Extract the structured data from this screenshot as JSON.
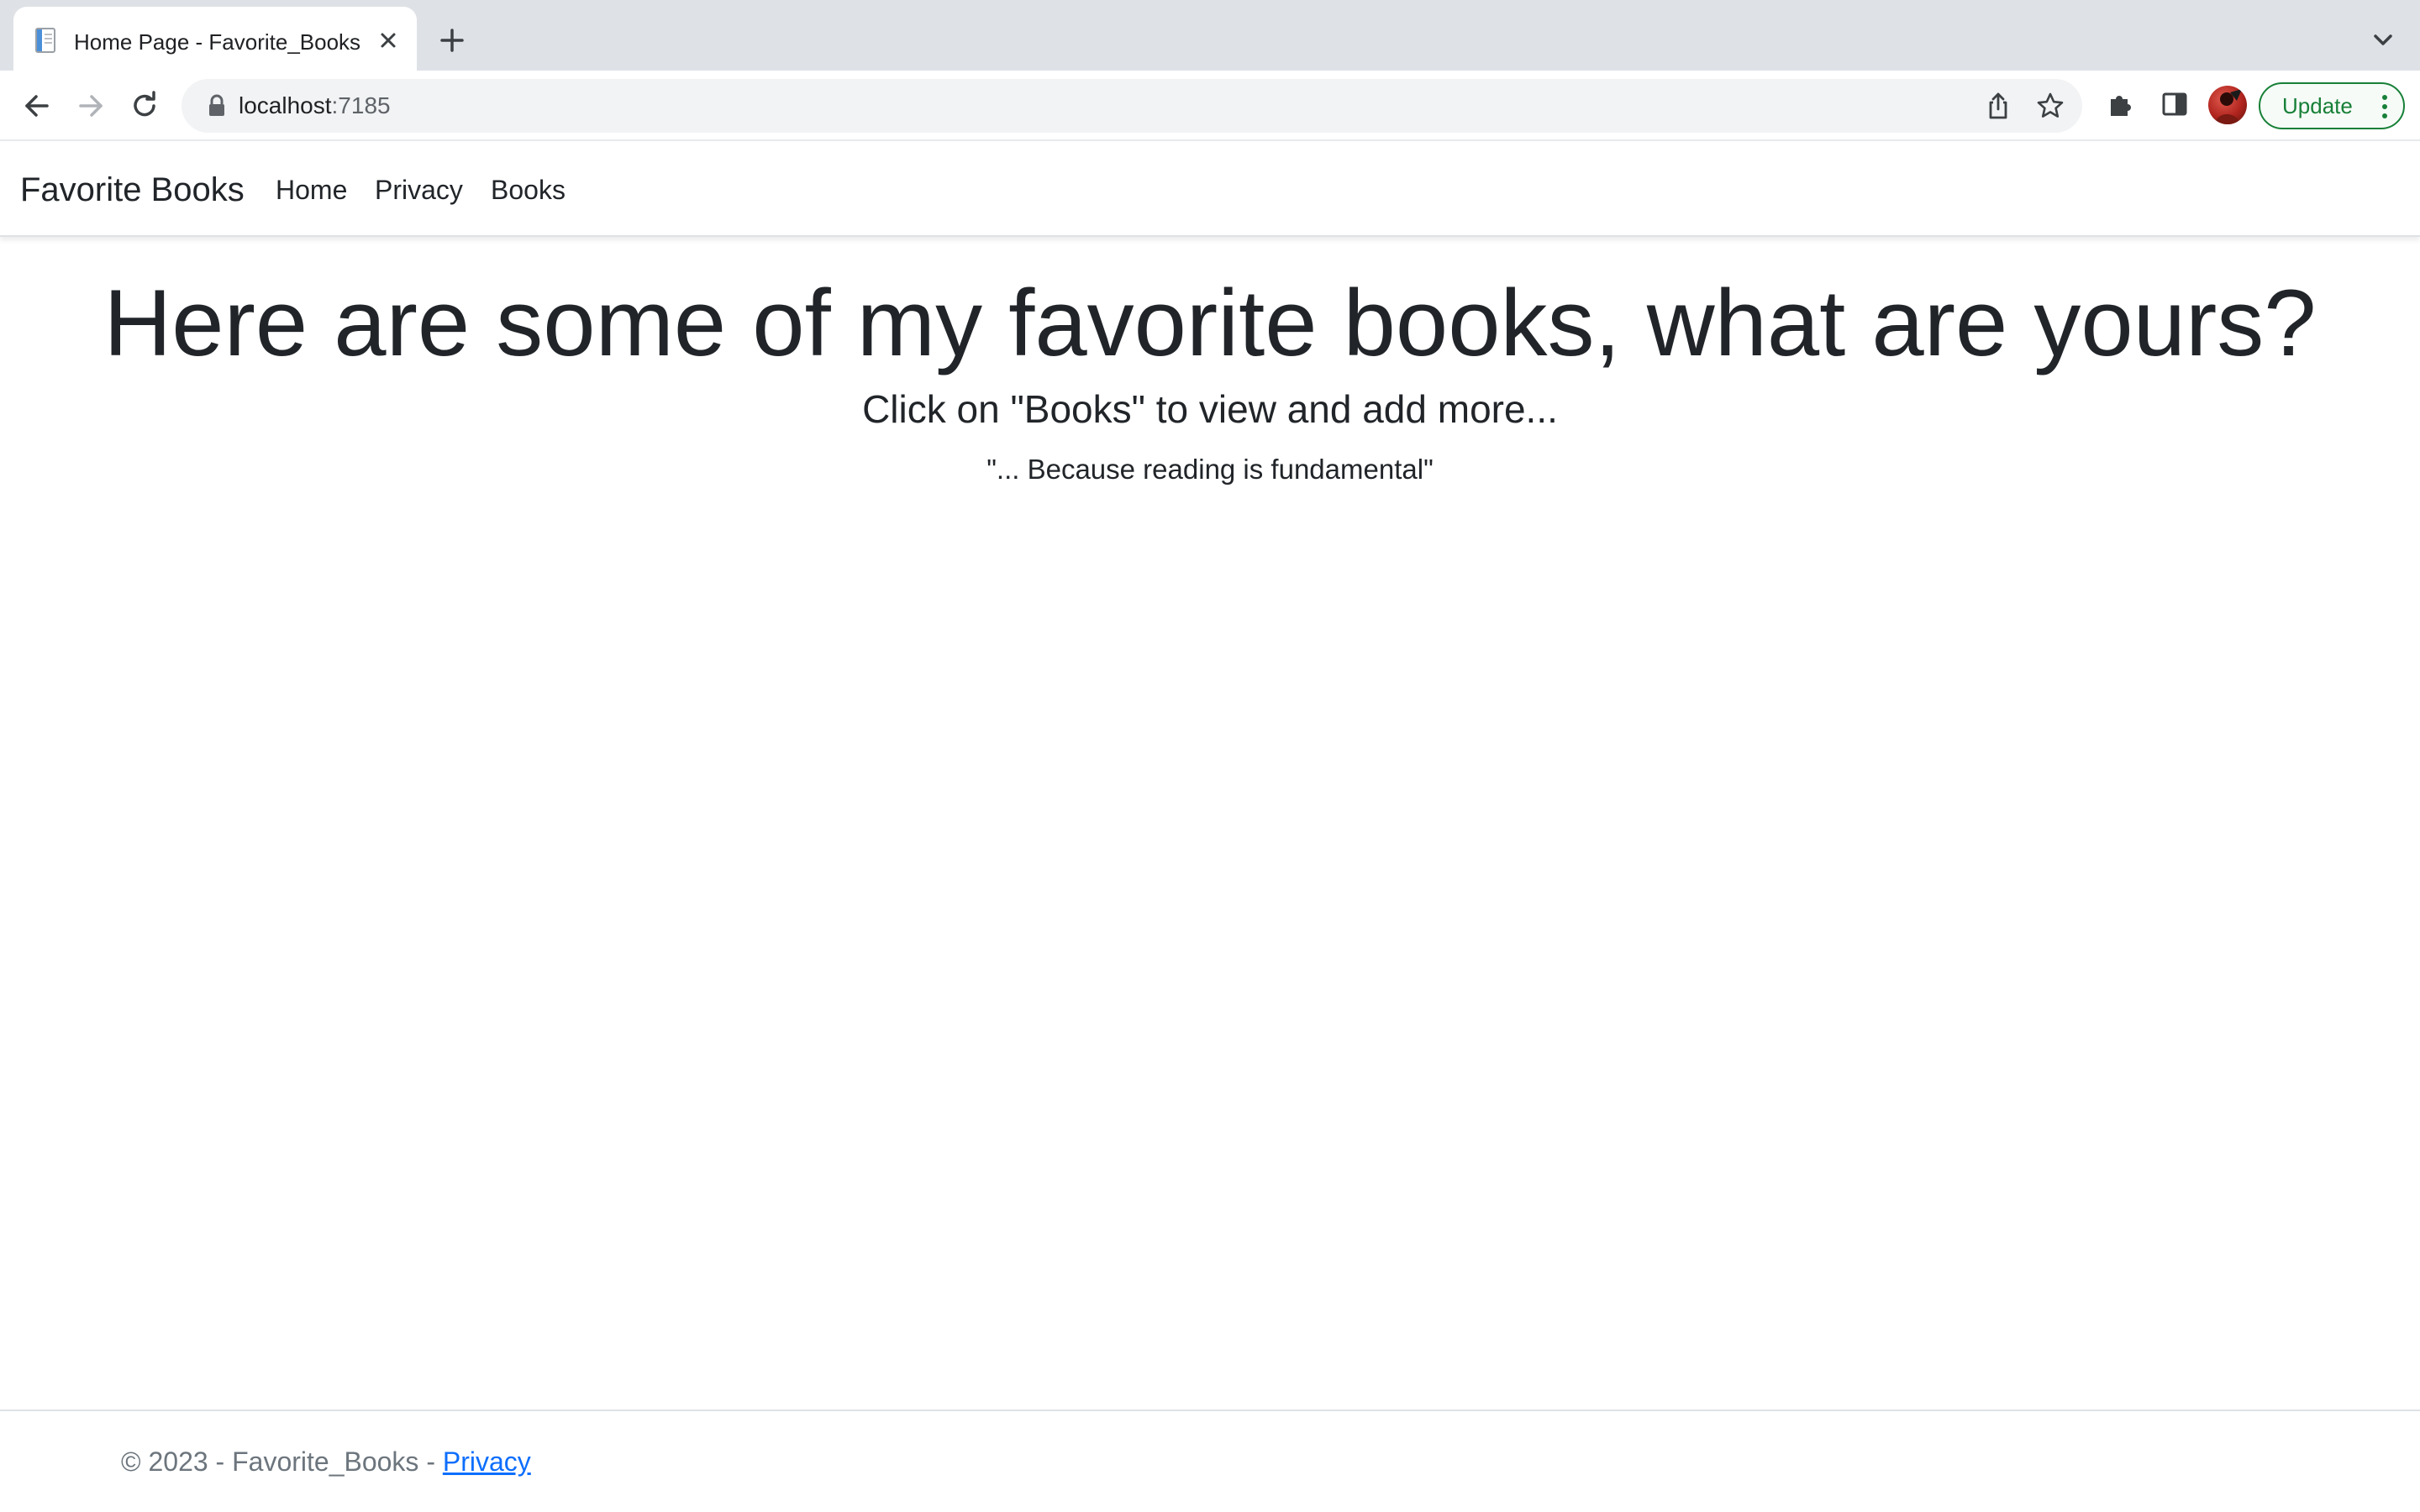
{
  "browser": {
    "tab": {
      "title": "Home Page - Favorite_Books",
      "favicon": "document-icon",
      "close_icon": "close-icon"
    },
    "new_tab_icon": "plus-icon",
    "tab_search_icon": "chevron-down-icon",
    "address_bar": {
      "host": "localhost",
      "port": ":7185",
      "security_icon": "lock-icon"
    },
    "toolbar_icons": [
      "back-icon",
      "forward-icon",
      "reload-icon",
      "share-icon",
      "bookmark-star-icon",
      "extensions-icon",
      "side-panel-icon"
    ],
    "update_button": {
      "label": "Update",
      "accent": "#188038"
    }
  },
  "site": {
    "brand": "Favorite Books",
    "nav": {
      "home": "Home",
      "privacy": "Privacy",
      "books": "Books"
    },
    "hero": {
      "title": "Here are some of my favorite books, what are yours?",
      "subtitle": "Click on \"Books\" to view and add more...",
      "quote": "\"... Because reading is fundamental\""
    },
    "footer": {
      "text": "© 2023 - Favorite_Books - ",
      "link": "Privacy",
      "link_color": "#0d6efd"
    }
  }
}
